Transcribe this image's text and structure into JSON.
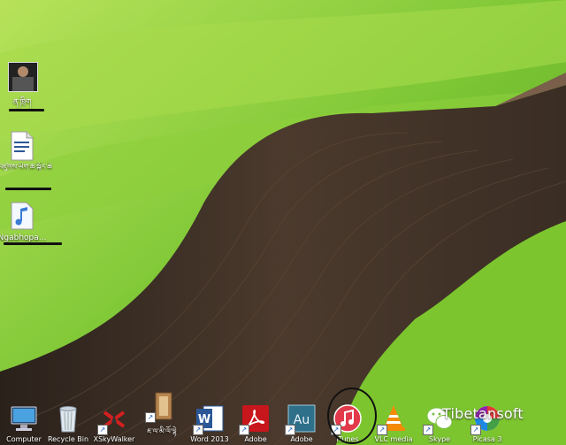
{
  "desktop": {
    "left_icons": [
      {
        "label": "ན་ཁྲིག",
        "icon": "photo-thumbnail-icon"
      },
      {
        "label": "ཁ་འཛུགས་ཡིག་ཆ་སྐོར་ཆེ",
        "icon": "word-document-icon"
      },
      {
        "label": "Ngabhopa...",
        "icon": "audio-file-icon"
      }
    ],
    "taskbar_icons": [
      {
        "label": "Computer",
        "icon": "computer-icon"
      },
      {
        "label": "Recycle Bin",
        "icon": "recycle-bin-icon"
      },
      {
        "label": "XSkyWalker",
        "icon": "xskywalker-icon"
      },
      {
        "label": "ཇ་ལ་མི་ལོ་ལྷེ",
        "icon": "tibetan-app-icon"
      },
      {
        "label": "Word 2013",
        "icon": "word-icon"
      },
      {
        "label": "Adobe",
        "icon": "adobe-reader-icon"
      },
      {
        "label": "Adobe",
        "icon": "adobe-audition-icon"
      },
      {
        "label": "iTunes",
        "icon": "itunes-icon"
      },
      {
        "label": "VLC media",
        "icon": "vlc-icon"
      },
      {
        "label": "Skype",
        "icon": "wechat-icon"
      },
      {
        "label": "Picasa 3",
        "icon": "picasa-icon"
      }
    ],
    "watermark": "Tibetansoft",
    "colors": {
      "grass_light": "#9ed845",
      "grass_dark": "#4f9a1f",
      "soil": "#3f3128",
      "itunes_red": "#e23a4a",
      "adobe_red": "#c8161d",
      "word_blue": "#2b5797",
      "audition_teal": "#2e6f8a"
    }
  }
}
